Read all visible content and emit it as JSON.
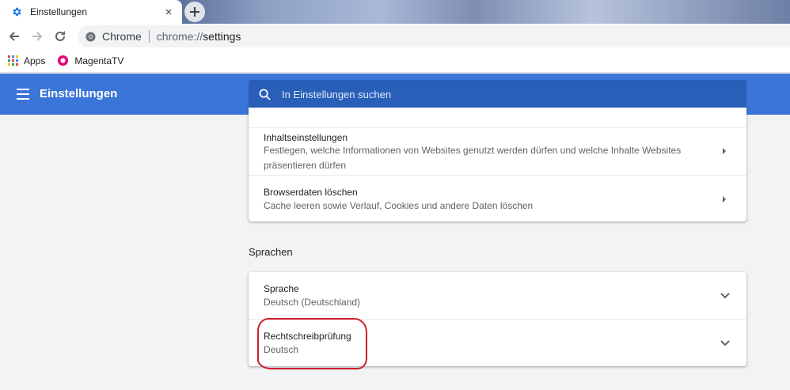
{
  "tab": {
    "title": "Einstellungen",
    "close_glyph": "×",
    "icon": "gear-icon"
  },
  "toolbar": {
    "site_label": "Chrome",
    "url_scheme": "chrome://",
    "url_path": "settings"
  },
  "bookmarks": [
    {
      "label": "Apps",
      "icon": "apps-grid-icon"
    },
    {
      "label": "MagentaTV",
      "icon": "magenta-tv-icon"
    }
  ],
  "header": {
    "title": "Einstellungen",
    "search_placeholder": "In Einstellungen suchen"
  },
  "privacy": {
    "items": [
      {
        "title": "Inhaltseinstellungen",
        "subtitle": "Festlegen, welche Informationen von Websites genutzt werden dürfen und welche Inhalte Websites präsentieren dürfen"
      },
      {
        "title": "Browserdaten löschen",
        "subtitle": "Cache leeren sowie Verlauf, Cookies und andere Daten löschen"
      }
    ]
  },
  "languages": {
    "section_title": "Sprachen",
    "items": [
      {
        "title": "Sprache",
        "subtitle": "Deutsch (Deutschland)"
      },
      {
        "title": "Rechtschreibprüfung",
        "subtitle": "Deutsch"
      }
    ]
  },
  "colors": {
    "header": "#3b75d8",
    "search": "#2a5fb9",
    "annotation": "#cc1f2d"
  }
}
